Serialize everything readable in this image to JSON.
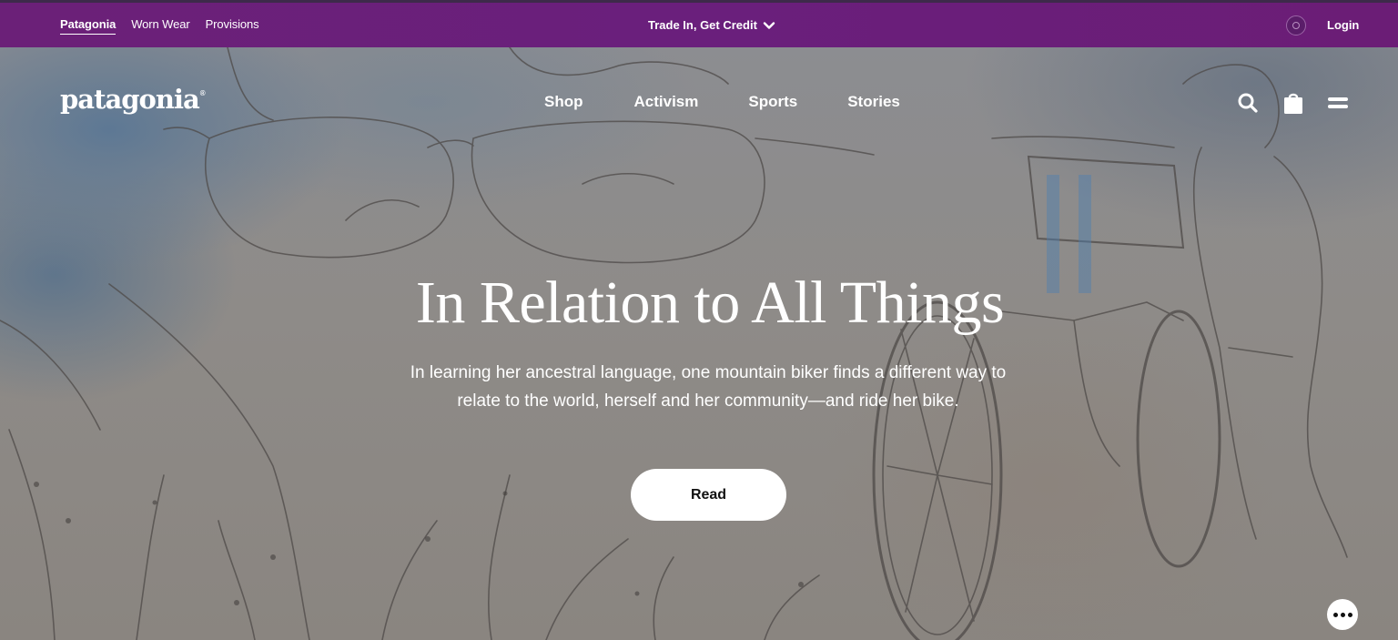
{
  "topbar": {
    "brands": [
      {
        "label": "Patagonia",
        "active": true
      },
      {
        "label": "Worn Wear",
        "active": false
      },
      {
        "label": "Provisions",
        "active": false
      }
    ],
    "promo_label": "Trade In, Get Credit",
    "login_label": "Login"
  },
  "nav": {
    "logo": "patagonia",
    "logo_mark": "®",
    "links": [
      "Shop",
      "Activism",
      "Sports",
      "Stories"
    ],
    "icons": [
      "search-icon",
      "shopping-bag-icon",
      "menu-icon"
    ]
  },
  "hero": {
    "title": "In Relation to All Things",
    "subtitle": "In learning her ancestral language, one mountain biker finds a different way to relate to the world, herself and her community—and ride her bike.",
    "cta_label": "Read"
  },
  "colors": {
    "topbar": "#6a1f7c",
    "text": "#ffffff",
    "button_bg": "#ffffff"
  }
}
